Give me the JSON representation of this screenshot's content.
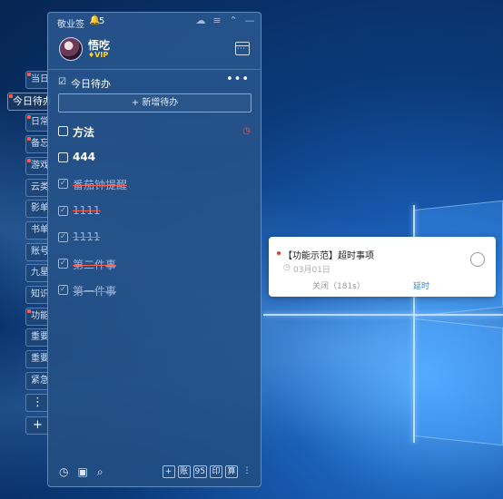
{
  "app": {
    "name": "敬业签",
    "notification_count": "5"
  },
  "user": {
    "name": "悟吃",
    "badge": "VIP"
  },
  "side_tabs": [
    {
      "label": "当日",
      "dot": true
    },
    {
      "label": "今日待办",
      "dot": true,
      "active": true
    },
    {
      "label": "日常",
      "dot": true
    },
    {
      "label": "备忘",
      "dot": true
    },
    {
      "label": "游戏",
      "dot": true
    },
    {
      "label": "云类",
      "dot": false
    },
    {
      "label": "影单",
      "dot": false
    },
    {
      "label": "书单",
      "dot": false
    },
    {
      "label": "账号",
      "dot": false
    },
    {
      "label": "九星",
      "dot": false
    },
    {
      "label": "知识",
      "dot": false
    },
    {
      "label": "功能",
      "dot": true
    },
    {
      "label": "重要",
      "dot": false
    },
    {
      "label": "重要",
      "dot": false
    },
    {
      "label": "紧急",
      "dot": false
    }
  ],
  "side_more": "⋮",
  "side_add": "+",
  "section": {
    "title": "今日待办",
    "add_label": "+ 新增待办"
  },
  "todos": [
    {
      "text": "方法",
      "done": false,
      "reminder": true
    },
    {
      "text": "444",
      "done": false,
      "reminder": false
    },
    {
      "text": "番茄钟提醒",
      "done": true,
      "reminder": false
    },
    {
      "text": "1111",
      "done": true,
      "reminder": false
    },
    {
      "text": "1111",
      "done": true,
      "reminder": false
    },
    {
      "text": "第二件事",
      "done": true,
      "reminder": false
    },
    {
      "text": "第一件事",
      "done": true,
      "reminder": false
    }
  ],
  "bottom_right_buttons": [
    "+",
    "账",
    "95",
    "印",
    "算",
    "⋮"
  ],
  "notification": {
    "title": "【功能示范】超时事项",
    "date": "03月01日",
    "close_label": "关闭（181s）",
    "delay_label": "延时"
  },
  "colors": {
    "accent_red": "#ff5a4a",
    "link_blue": "#2e86de",
    "vip_gold": "#ffd23a"
  }
}
